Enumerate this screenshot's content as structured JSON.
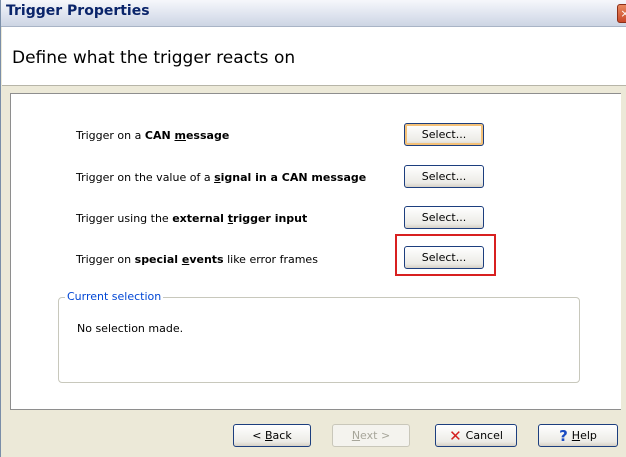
{
  "window": {
    "title": "Trigger Properties",
    "close_glyph": "×"
  },
  "header": {
    "title": "Define what the trigger reacts on"
  },
  "rows": [
    {
      "prefix": "Trigger on a ",
      "bold1": "CAN ",
      "bold_under": "m",
      "bold2": "essage",
      "suffix": "",
      "button": "Select..."
    },
    {
      "prefix": "Trigger on the value of a ",
      "bold1": "",
      "bold_under": "s",
      "bold2": "ignal in a CAN message",
      "suffix": "",
      "button": "Select..."
    },
    {
      "prefix": "Trigger using the ",
      "bold1": "external ",
      "bold_under": "t",
      "bold2": "rigger input",
      "suffix": "",
      "button": "Select..."
    },
    {
      "prefix": "Trigger on ",
      "bold1": "special ",
      "bold_under": "e",
      "bold2": "vents",
      "suffix": " like error frames",
      "button": "Select..."
    }
  ],
  "current_selection": {
    "legend": "Current selection",
    "text": "No selection made."
  },
  "footer": {
    "back": {
      "under": "B",
      "rest": "ack",
      "prefix": "< "
    },
    "next": {
      "under": "N",
      "rest": "ext >"
    },
    "cancel": {
      "glyph": "✕",
      "label": "Cancel"
    },
    "help": {
      "glyph": "?",
      "under": "H",
      "rest": "elp"
    }
  }
}
